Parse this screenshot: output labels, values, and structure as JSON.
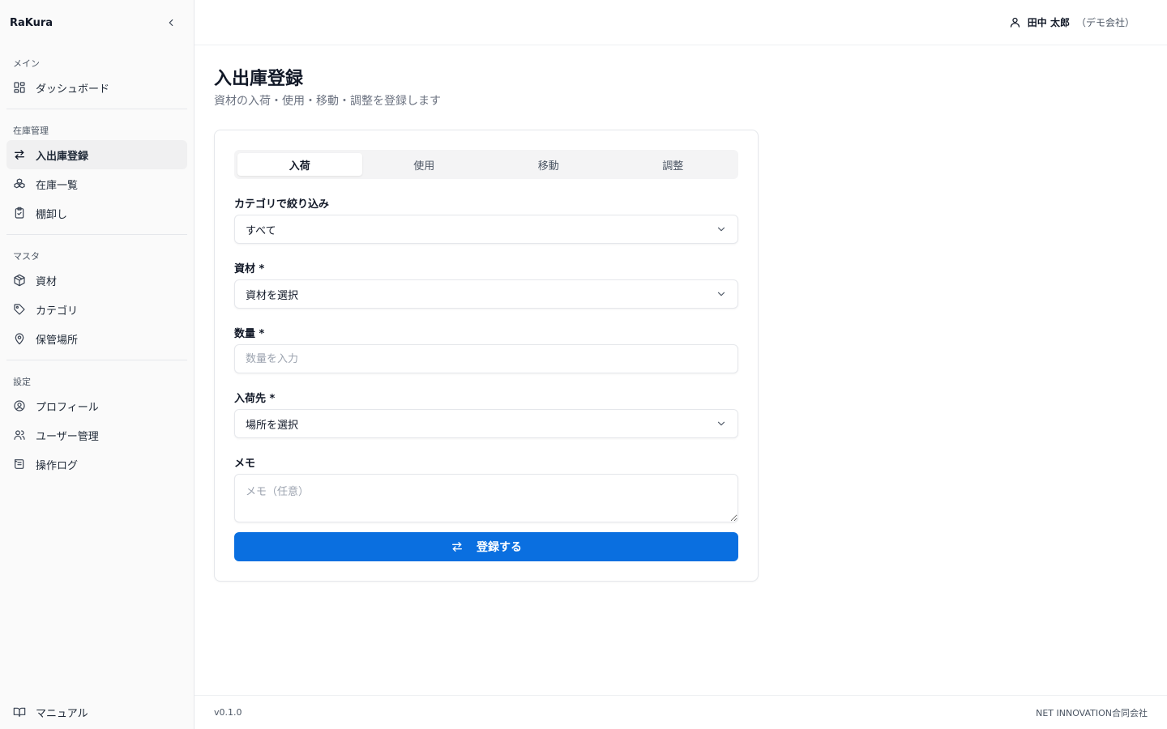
{
  "sidebar": {
    "brand": "RaKura",
    "groups": [
      {
        "label": "メイン",
        "items": [
          {
            "label": "ダッシュボード",
            "icon": "dashboard-icon"
          }
        ]
      },
      {
        "label": "在庫管理",
        "items": [
          {
            "label": "入出庫登録",
            "icon": "arrows-exchange-icon",
            "active": true
          },
          {
            "label": "在庫一覧",
            "icon": "boxes-icon"
          },
          {
            "label": "棚卸し",
            "icon": "clipboard-check-icon"
          }
        ]
      },
      {
        "label": "マスタ",
        "items": [
          {
            "label": "資材",
            "icon": "package-icon"
          },
          {
            "label": "カテゴリ",
            "icon": "tag-icon"
          },
          {
            "label": "保管場所",
            "icon": "map-pin-icon"
          }
        ]
      },
      {
        "label": "設定",
        "items": [
          {
            "label": "プロフィール",
            "icon": "user-circle-icon"
          },
          {
            "label": "ユーザー管理",
            "icon": "users-icon"
          },
          {
            "label": "操作ログ",
            "icon": "log-scroll-icon"
          }
        ]
      }
    ],
    "footer_item": {
      "label": "マニュアル",
      "icon": "book-open-icon"
    }
  },
  "topbar": {
    "user_name": "田中 太郎",
    "user_company": "（デモ会社）"
  },
  "page": {
    "title": "入出庫登録",
    "subtitle": "資材の入荷・使用・移動・調整を登録します"
  },
  "tabs": [
    {
      "label": "入荷",
      "active": true
    },
    {
      "label": "使用"
    },
    {
      "label": "移動"
    },
    {
      "label": "調整"
    }
  ],
  "form": {
    "category": {
      "label": "カテゴリで絞り込み",
      "value": "すべて"
    },
    "material": {
      "label": "資材 *",
      "value": "資材を選択"
    },
    "quantity": {
      "label": "数量 *",
      "placeholder": "数量を入力"
    },
    "destination": {
      "label": "入荷先 *",
      "value": "場所を選択"
    },
    "memo": {
      "label": "メモ",
      "placeholder": "メモ（任意）"
    },
    "submit_label": "登録する"
  },
  "footer": {
    "version": "v0.1.0",
    "company": "NET INNOVATION合同会社"
  },
  "colors": {
    "primary": "#0a6fe0",
    "sidebar_bg": "#fafafa",
    "active_bg": "#f0f0f1"
  }
}
